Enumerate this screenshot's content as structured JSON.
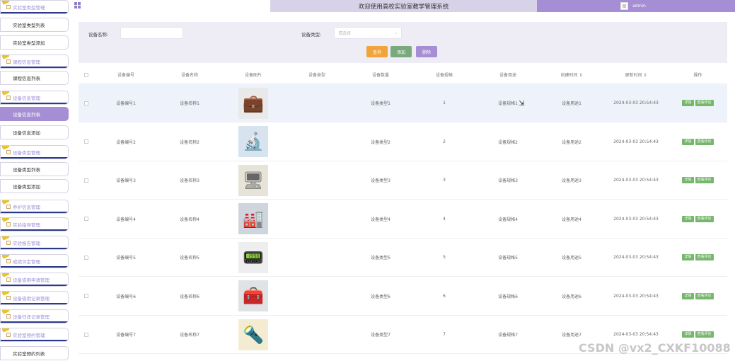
{
  "app": {
    "title": "欢迎使用高校实验室教学管理系统",
    "user": "admin",
    "avatar_alt": "图"
  },
  "sidebar": {
    "items": [
      {
        "label": "实验室类型管理",
        "kind": "group"
      },
      {
        "label": "实验室类型列表",
        "kind": "item"
      },
      {
        "label": "实验室类型添加",
        "kind": "item"
      },
      {
        "label": "课程信息管理",
        "kind": "group"
      },
      {
        "label": "课程信息列表",
        "kind": "item"
      },
      {
        "label": "设备信息管理",
        "kind": "group"
      },
      {
        "label": "设备信息列表",
        "kind": "active"
      },
      {
        "label": "设备信息添加",
        "kind": "item"
      },
      {
        "label": "设备类型管理",
        "kind": "group"
      },
      {
        "label": "设备类型列表",
        "kind": "item"
      },
      {
        "label": "设备类型添加",
        "kind": "item"
      },
      {
        "label": "养护信息管理",
        "kind": "group"
      },
      {
        "label": "实验指导管理",
        "kind": "group"
      },
      {
        "label": "实验报告管理",
        "kind": "group"
      },
      {
        "label": "成绩评定管理",
        "kind": "group"
      },
      {
        "label": "设备借用申请管理",
        "kind": "group"
      },
      {
        "label": "设备借用记录管理",
        "kind": "group"
      },
      {
        "label": "设备归还记录管理",
        "kind": "group"
      },
      {
        "label": "实验室预约管理",
        "kind": "group"
      },
      {
        "label": "实验室预约列表",
        "kind": "item"
      }
    ]
  },
  "search": {
    "name_label": "设备名称:",
    "name_value": "",
    "type_label": "设备类型:",
    "type_placeholder": "请选择",
    "query_button": "查询",
    "add_button": "添加",
    "delete_button": "删除"
  },
  "table": {
    "headers": [
      "设备编号",
      "设备名称",
      "设备图片",
      "设备类型",
      "设备数量",
      "设备规格",
      "设备用途",
      "创建时间 ⇕",
      "更新时间 ⇕",
      "操作"
    ],
    "rows": [
      {
        "no": "设备编号1",
        "name": "设备名称1",
        "type": "设备类型1",
        "qty": "1",
        "spec": "设备规格1",
        "use": "设备用途1",
        "created": "2024-03-03 20:54:43",
        "updated": "2024-03-03 20:54:43",
        "icon": "💼"
      },
      {
        "no": "设备编号2",
        "name": "设备名称2",
        "type": "设备类型2",
        "qty": "2",
        "spec": "设备规格2",
        "use": "设备用途2",
        "created": "2024-03-03 20:54:43",
        "updated": "2024-03-03 20:54:43",
        "icon": "🔬"
      },
      {
        "no": "设备编号3",
        "name": "设备名称3",
        "type": "设备类型3",
        "qty": "3",
        "spec": "设备规格3",
        "use": "设备用途3",
        "created": "2024-03-03 20:54:43",
        "updated": "2024-03-03 20:54:43",
        "icon": "🖥"
      },
      {
        "no": "设备编号4",
        "name": "设备名称4",
        "type": "设备类型4",
        "qty": "4",
        "spec": "设备规格4",
        "use": "设备用途4",
        "created": "2024-03-03 20:54:43",
        "updated": "2024-03-03 20:54:43",
        "icon": "🏭"
      },
      {
        "no": "设备编号5",
        "name": "设备名称5",
        "type": "设备类型5",
        "qty": "5",
        "spec": "设备规格5",
        "use": "设备用途5",
        "created": "2024-03-03 20:54:43",
        "updated": "2024-03-03 20:54:43",
        "icon": "📟"
      },
      {
        "no": "设备编号6",
        "name": "设备名称6",
        "type": "设备类型6",
        "qty": "6",
        "spec": "设备规格6",
        "use": "设备用途6",
        "created": "2024-03-03 20:54:43",
        "updated": "2024-03-03 20:54:43",
        "icon": "🧰"
      },
      {
        "no": "设备编号7",
        "name": "设备名称7",
        "type": "设备类型7",
        "qty": "7",
        "spec": "设备规格7",
        "use": "设备用途7",
        "created": "2024-03-03 20:54:43",
        "updated": "2024-03-03 20:54:43",
        "icon": "🔦"
      }
    ],
    "edit_label": "详情",
    "review_label": "查看评论"
  },
  "watermark": "CSDN @vx2_CXKF10088",
  "colors": {
    "accent": "#a58ed4",
    "query": "#f0a43a",
    "add": "#7aa97e",
    "delete": "#a58ed4",
    "action": "#76b76c"
  }
}
